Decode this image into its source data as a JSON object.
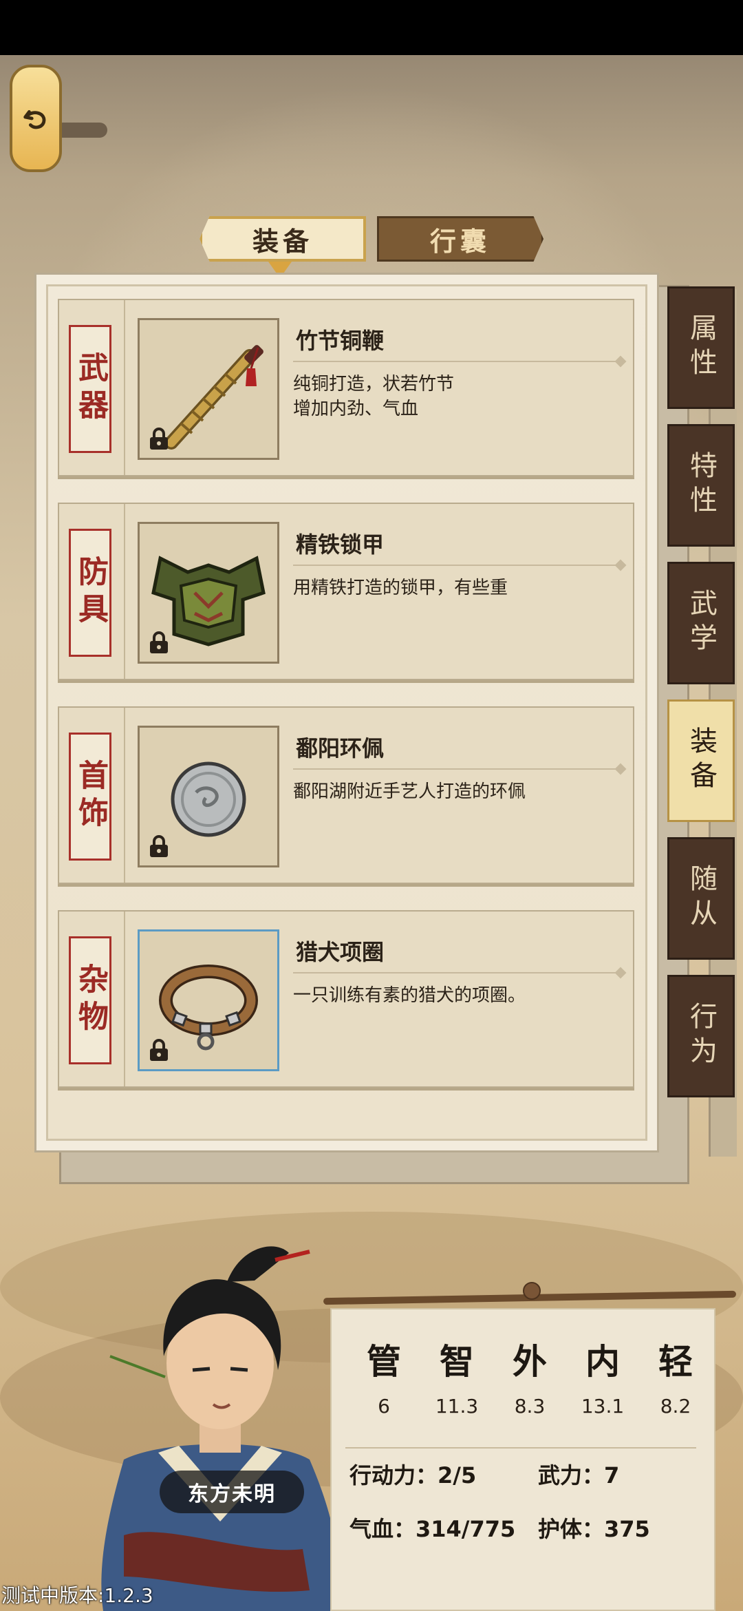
{
  "tabs": {
    "equipment": "装备",
    "bag": "行囊"
  },
  "slots": [
    {
      "category": "武器",
      "name": "竹节铜鞭",
      "desc": "纯铜打造，状若竹节\n增加内劲、气血",
      "icon": "bamboo-whip-icon"
    },
    {
      "category": "防具",
      "name": "精铁锁甲",
      "desc": "用精铁打造的锁甲，有些重",
      "icon": "armor-icon"
    },
    {
      "category": "首饰",
      "name": "鄱阳环佩",
      "desc": "鄱阳湖附近手艺人打造的环佩",
      "icon": "jade-ring-icon"
    },
    {
      "category": "杂物",
      "name": "猎犬项圈",
      "desc": "一只训练有素的猎犬的项圈。",
      "icon": "dog-collar-icon"
    }
  ],
  "side_tabs": [
    "属性",
    "特性",
    "武学",
    "装备",
    "随从",
    "行为"
  ],
  "active_side_tab": "装备",
  "character": {
    "name": "东方未明"
  },
  "stats": [
    {
      "glyph": "管",
      "value": "6"
    },
    {
      "glyph": "智",
      "value": "11.3"
    },
    {
      "glyph": "外",
      "value": "8.3"
    },
    {
      "glyph": "内",
      "value": "13.1"
    },
    {
      "glyph": "轻",
      "value": "8.2"
    }
  ],
  "attributes": {
    "action": "行动力：2/5",
    "force": "武力：7",
    "hp": "气血：314/775",
    "guard": "护体：375"
  },
  "version": "测试中版本:1.2.3",
  "colors": {
    "accent_red": "#9b2a24",
    "panel": "#f3ecdd",
    "side_tab": "#4a3426",
    "active_tab": "#f0dfa9"
  }
}
